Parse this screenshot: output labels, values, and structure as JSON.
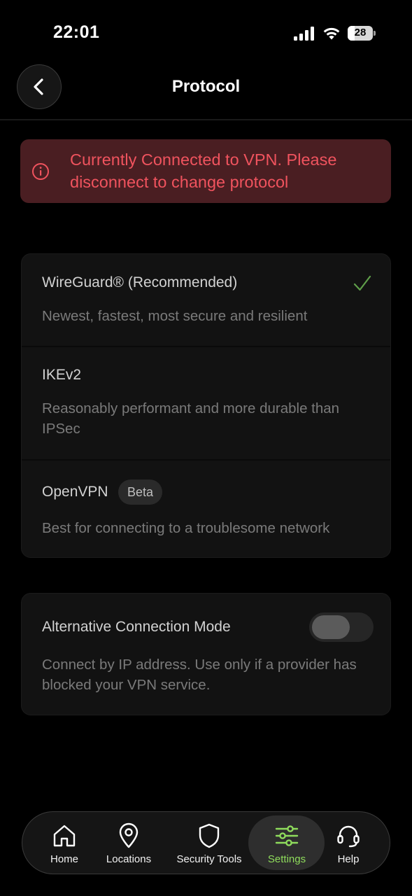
{
  "status_bar": {
    "time": "22:01",
    "battery": "28"
  },
  "header": {
    "title": "Protocol",
    "back_icon": "chevron-left-icon"
  },
  "banner": {
    "icon": "info-circle-icon",
    "message": "Currently Connected to VPN. Please disconnect to change protocol",
    "color": "#f0535e"
  },
  "protocols": [
    {
      "title": "WireGuard® (Recommended)",
      "description": "Newest, fastest, most secure and resilient",
      "selected": true
    },
    {
      "title": "IKEv2",
      "description": "Reasonably performant and more durable than IPSec",
      "selected": false
    },
    {
      "title": "OpenVPN",
      "badge": "Beta",
      "description": "Best for connecting to a troublesome network",
      "selected": false
    }
  ],
  "alternative_mode": {
    "title": "Alternative Connection Mode",
    "description": "Connect by IP address. Use only if a provider has blocked your VPN service.",
    "enabled": false
  },
  "tabbar": {
    "active_color": "#8fdc5c",
    "items": [
      {
        "label": "Home",
        "icon": "home-icon"
      },
      {
        "label": "Locations",
        "icon": "location-pin-icon"
      },
      {
        "label": "Security Tools",
        "icon": "shield-icon"
      },
      {
        "label": "Settings",
        "icon": "sliders-icon",
        "active": true
      },
      {
        "label": "Help",
        "icon": "headset-icon"
      }
    ]
  }
}
